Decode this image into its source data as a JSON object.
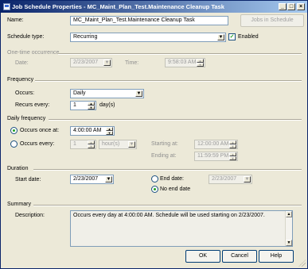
{
  "window": {
    "title": "Job Schedule Properties - MC_Maint_Plan_Test.Maintenance Cleanup Task"
  },
  "general": {
    "name_label": "Name:",
    "name_value": "MC_Maint_Plan_Test.Maintenance Cleanup Task",
    "jobs_button": "Jobs in Schedule",
    "schedule_type_label": "Schedule type:",
    "schedule_type_value": "Recurring",
    "enabled_label": "Enabled",
    "enabled": true
  },
  "one_time": {
    "section_title": "One-time occurrence",
    "date_label": "Date:",
    "date_value": "2/23/2007",
    "time_label": "Time:",
    "time_value": "9:58:03 AM"
  },
  "frequency": {
    "section_title": "Frequency",
    "occurs_label": "Occurs:",
    "occurs_value": "Daily",
    "recurs_label": "Recurs every:",
    "recurs_value": "1",
    "recurs_unit": "day(s)"
  },
  "daily_frequency": {
    "section_title": "Daily frequency",
    "once_label": "Occurs once at:",
    "once_value": "4:00:00 AM",
    "every_label": "Occurs every:",
    "every_value": "1",
    "every_unit": "hour(s)",
    "starting_label": "Starting at:",
    "starting_value": "12:00:00 AM",
    "ending_label": "Ending at:",
    "ending_value": "11:59:59 PM"
  },
  "duration": {
    "section_title": "Duration",
    "start_label": "Start date:",
    "start_value": "2/23/2007",
    "end_label": "End date:",
    "end_value": "2/23/2007",
    "no_end_label": "No end date"
  },
  "summary": {
    "section_title": "Summary",
    "description_label": "Description:",
    "description_value": "Occurs every day at 4:00:00 AM. Schedule will be used starting on 2/23/2007."
  },
  "buttons": {
    "ok": "OK",
    "cancel": "Cancel",
    "help": "Help"
  }
}
